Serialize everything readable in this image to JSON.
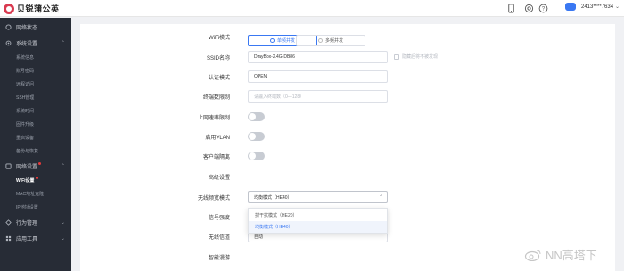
{
  "header": {
    "brand": "贝锐蒲公英",
    "user_name": "2413****7634",
    "icons": [
      "phone-icon",
      "support-icon",
      "help-icon"
    ]
  },
  "sidebar": {
    "items": [
      {
        "label": "网络状态",
        "icon": "network-status-icon"
      },
      {
        "label": "系统设置",
        "icon": "system-settings-icon",
        "expanded": true
      }
    ],
    "system_sub": [
      "系统信息",
      "账号密码",
      "远程访问",
      "SSH管理",
      "系统时间",
      "固件升级",
      "重启设备",
      "备份与恢复"
    ],
    "network_settings": {
      "label": "网络设置",
      "icon": "network-settings-icon",
      "expanded": true,
      "badge_color": "#e63a3a"
    },
    "network_sub": [
      {
        "label": "WiFi设置",
        "active": true
      },
      {
        "label": "MAC地址克隆",
        "active": false
      },
      {
        "label": "IP地址设置",
        "active": false
      }
    ],
    "behavior": {
      "label": "行为管理",
      "icon": "behavior-management-icon"
    },
    "apps": {
      "label": "应用工具",
      "icon": "app-tools-icon"
    }
  },
  "form": {
    "wifi_mode": {
      "label": "WiFi模式",
      "options": [
        "单频并发",
        "多频并发"
      ],
      "selected": "单频并发"
    },
    "ssid": {
      "label": "SSID名称",
      "value": "DrayBox-2.4G-DB86"
    },
    "hide_ssid": {
      "label": "隐藏后将不被发现"
    },
    "auth": {
      "label": "认证模式",
      "value": "OPEN"
    },
    "max_clients": {
      "label": "终端数限制",
      "placeholder": "请输入终端数（0—128）"
    },
    "internet_limit": {
      "label": "上网速率限制"
    },
    "vlan": {
      "label": "启用VLAN"
    },
    "isolation": {
      "label": "客户端隔离"
    },
    "advanced": {
      "label": "高级设置"
    },
    "bandwidth_mode": {
      "label": "无线频宽模式",
      "value": "均衡模式（HE40）"
    },
    "signal": {
      "label": "信号强度"
    },
    "channel": {
      "label": "无线信道",
      "value": "自动"
    },
    "smart_roaming": {
      "label": "智能漫游"
    }
  },
  "dropdown": {
    "options": [
      {
        "label": "抗干扰模式（HE20）",
        "selected": false
      },
      {
        "label": "均衡模式（HE40）",
        "selected": true
      }
    ]
  },
  "watermark": {
    "text": "NN高塔下"
  },
  "colors": {
    "accent": "#3a78f2",
    "sidebar_bg": "#272c36",
    "badge": "#e63a3a"
  }
}
